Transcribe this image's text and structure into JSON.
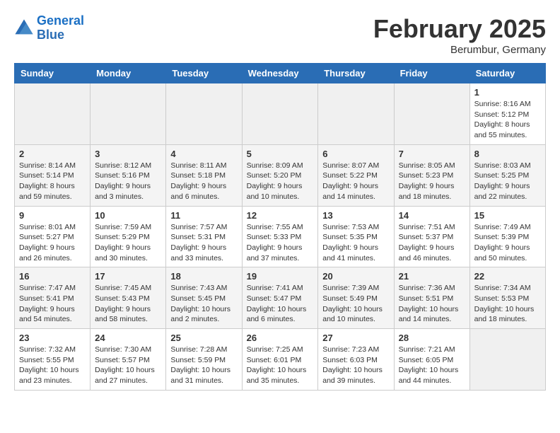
{
  "header": {
    "logo_line1": "General",
    "logo_line2": "Blue",
    "month": "February 2025",
    "location": "Berumbur, Germany"
  },
  "weekdays": [
    "Sunday",
    "Monday",
    "Tuesday",
    "Wednesday",
    "Thursday",
    "Friday",
    "Saturday"
  ],
  "weeks": [
    [
      {
        "day": "",
        "detail": ""
      },
      {
        "day": "",
        "detail": ""
      },
      {
        "day": "",
        "detail": ""
      },
      {
        "day": "",
        "detail": ""
      },
      {
        "day": "",
        "detail": ""
      },
      {
        "day": "",
        "detail": ""
      },
      {
        "day": "1",
        "detail": "Sunrise: 8:16 AM\nSunset: 5:12 PM\nDaylight: 8 hours and 55 minutes."
      }
    ],
    [
      {
        "day": "2",
        "detail": "Sunrise: 8:14 AM\nSunset: 5:14 PM\nDaylight: 8 hours and 59 minutes."
      },
      {
        "day": "3",
        "detail": "Sunrise: 8:12 AM\nSunset: 5:16 PM\nDaylight: 9 hours and 3 minutes."
      },
      {
        "day": "4",
        "detail": "Sunrise: 8:11 AM\nSunset: 5:18 PM\nDaylight: 9 hours and 6 minutes."
      },
      {
        "day": "5",
        "detail": "Sunrise: 8:09 AM\nSunset: 5:20 PM\nDaylight: 9 hours and 10 minutes."
      },
      {
        "day": "6",
        "detail": "Sunrise: 8:07 AM\nSunset: 5:22 PM\nDaylight: 9 hours and 14 minutes."
      },
      {
        "day": "7",
        "detail": "Sunrise: 8:05 AM\nSunset: 5:23 PM\nDaylight: 9 hours and 18 minutes."
      },
      {
        "day": "8",
        "detail": "Sunrise: 8:03 AM\nSunset: 5:25 PM\nDaylight: 9 hours and 22 minutes."
      }
    ],
    [
      {
        "day": "9",
        "detail": "Sunrise: 8:01 AM\nSunset: 5:27 PM\nDaylight: 9 hours and 26 minutes."
      },
      {
        "day": "10",
        "detail": "Sunrise: 7:59 AM\nSunset: 5:29 PM\nDaylight: 9 hours and 30 minutes."
      },
      {
        "day": "11",
        "detail": "Sunrise: 7:57 AM\nSunset: 5:31 PM\nDaylight: 9 hours and 33 minutes."
      },
      {
        "day": "12",
        "detail": "Sunrise: 7:55 AM\nSunset: 5:33 PM\nDaylight: 9 hours and 37 minutes."
      },
      {
        "day": "13",
        "detail": "Sunrise: 7:53 AM\nSunset: 5:35 PM\nDaylight: 9 hours and 41 minutes."
      },
      {
        "day": "14",
        "detail": "Sunrise: 7:51 AM\nSunset: 5:37 PM\nDaylight: 9 hours and 46 minutes."
      },
      {
        "day": "15",
        "detail": "Sunrise: 7:49 AM\nSunset: 5:39 PM\nDaylight: 9 hours and 50 minutes."
      }
    ],
    [
      {
        "day": "16",
        "detail": "Sunrise: 7:47 AM\nSunset: 5:41 PM\nDaylight: 9 hours and 54 minutes."
      },
      {
        "day": "17",
        "detail": "Sunrise: 7:45 AM\nSunset: 5:43 PM\nDaylight: 9 hours and 58 minutes."
      },
      {
        "day": "18",
        "detail": "Sunrise: 7:43 AM\nSunset: 5:45 PM\nDaylight: 10 hours and 2 minutes."
      },
      {
        "day": "19",
        "detail": "Sunrise: 7:41 AM\nSunset: 5:47 PM\nDaylight: 10 hours and 6 minutes."
      },
      {
        "day": "20",
        "detail": "Sunrise: 7:39 AM\nSunset: 5:49 PM\nDaylight: 10 hours and 10 minutes."
      },
      {
        "day": "21",
        "detail": "Sunrise: 7:36 AM\nSunset: 5:51 PM\nDaylight: 10 hours and 14 minutes."
      },
      {
        "day": "22",
        "detail": "Sunrise: 7:34 AM\nSunset: 5:53 PM\nDaylight: 10 hours and 18 minutes."
      }
    ],
    [
      {
        "day": "23",
        "detail": "Sunrise: 7:32 AM\nSunset: 5:55 PM\nDaylight: 10 hours and 23 minutes."
      },
      {
        "day": "24",
        "detail": "Sunrise: 7:30 AM\nSunset: 5:57 PM\nDaylight: 10 hours and 27 minutes."
      },
      {
        "day": "25",
        "detail": "Sunrise: 7:28 AM\nSunset: 5:59 PM\nDaylight: 10 hours and 31 minutes."
      },
      {
        "day": "26",
        "detail": "Sunrise: 7:25 AM\nSunset: 6:01 PM\nDaylight: 10 hours and 35 minutes."
      },
      {
        "day": "27",
        "detail": "Sunrise: 7:23 AM\nSunset: 6:03 PM\nDaylight: 10 hours and 39 minutes."
      },
      {
        "day": "28",
        "detail": "Sunrise: 7:21 AM\nSunset: 6:05 PM\nDaylight: 10 hours and 44 minutes."
      },
      {
        "day": "",
        "detail": ""
      }
    ]
  ]
}
